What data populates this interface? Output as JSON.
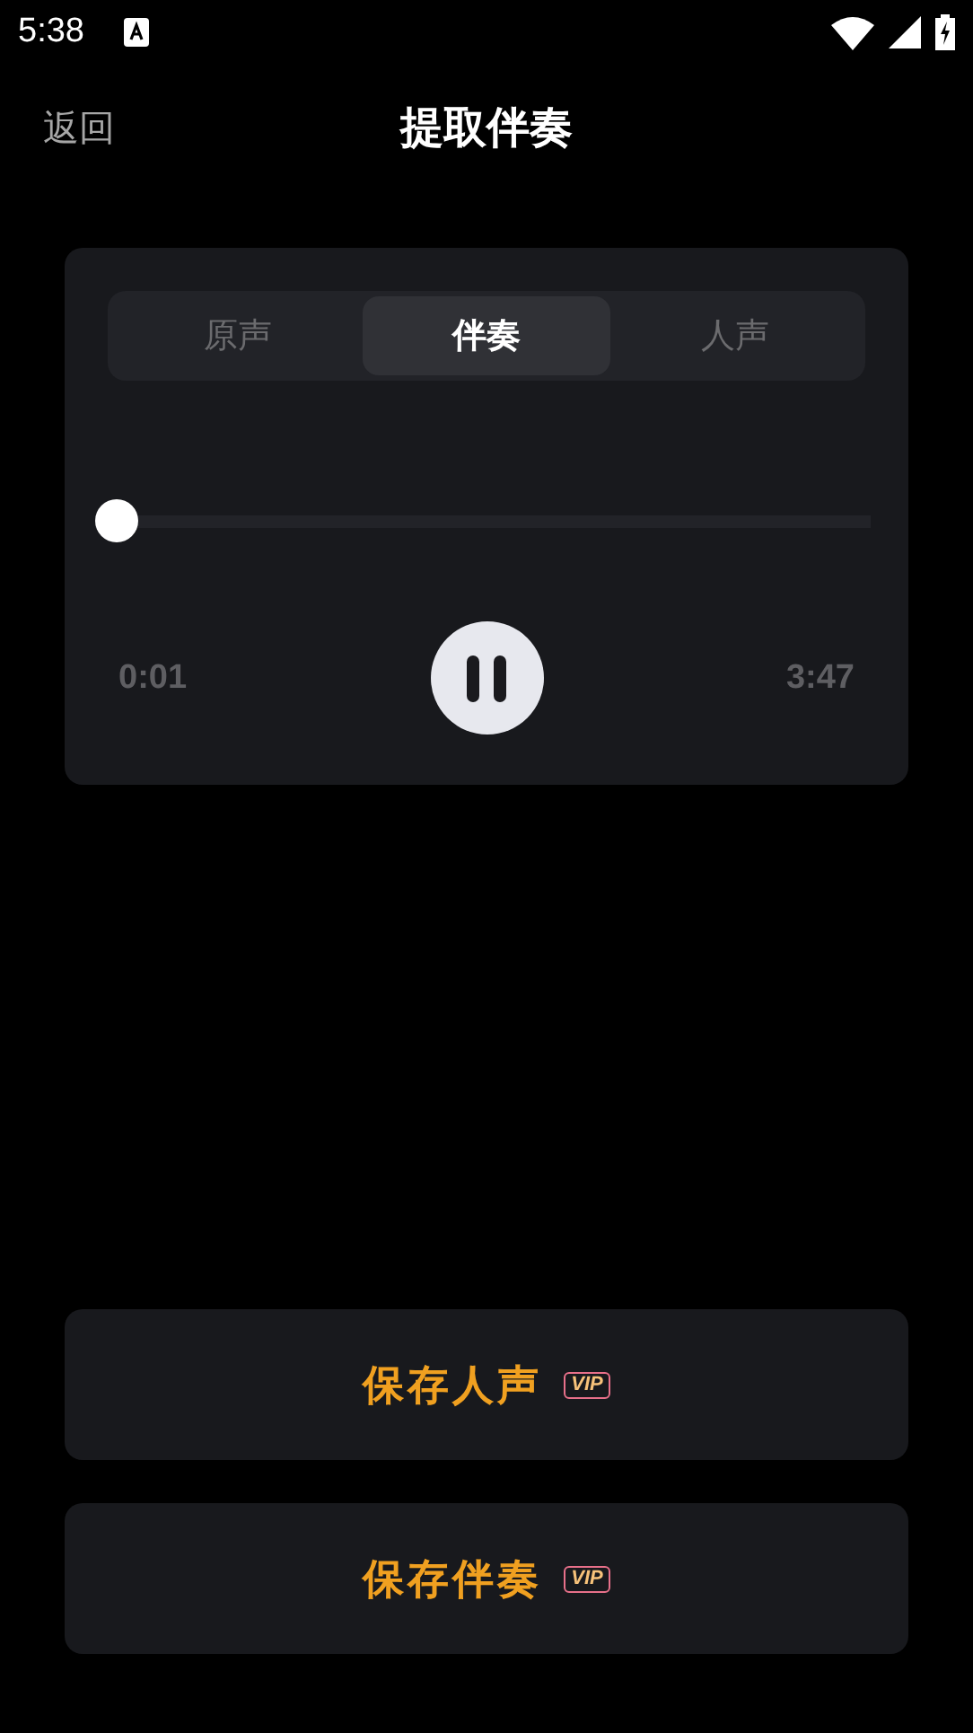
{
  "status_bar": {
    "time": "5:38"
  },
  "header": {
    "back": "返回",
    "title": "提取伴奏"
  },
  "player": {
    "tabs": [
      {
        "label": "原声",
        "selected": false
      },
      {
        "label": "伴奏",
        "selected": true
      },
      {
        "label": "人声",
        "selected": false
      }
    ],
    "progress": {
      "level": 0.005
    },
    "elapsed": "0:01",
    "duration": "3:47",
    "playing": true
  },
  "actions": [
    {
      "label": "保存人声",
      "badge": "VIP"
    },
    {
      "label": "保存伴奏",
      "badge": "VIP"
    }
  ]
}
